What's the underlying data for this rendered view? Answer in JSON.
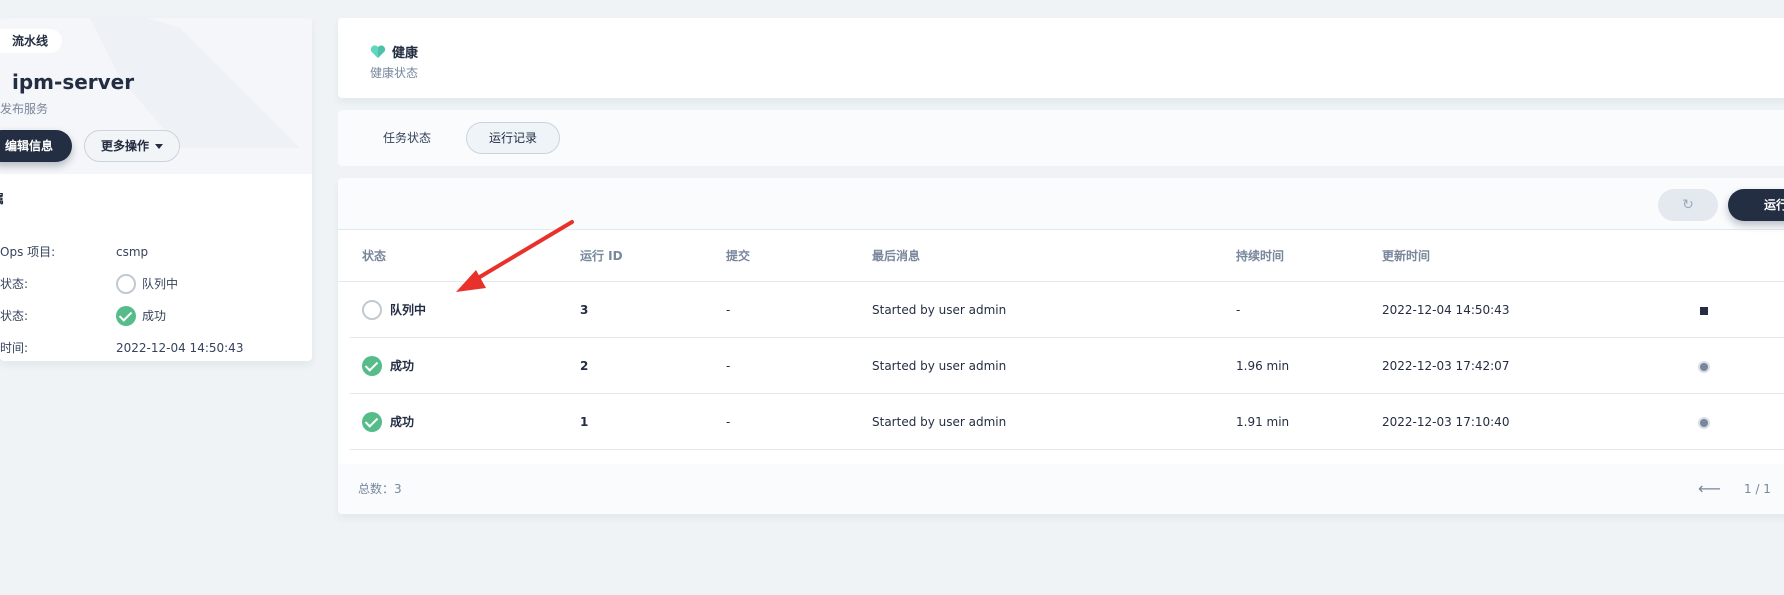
{
  "left": {
    "type_tag": "流水线",
    "name": "ipm-server",
    "description": "发布服务",
    "edit_button": "编辑信息",
    "more_button": "更多操作",
    "section_title": "属",
    "info": [
      {
        "label": "Ops 项目:",
        "value": "csmp",
        "status": ""
      },
      {
        "label": "状态:",
        "value": "队列中",
        "status": "queued"
      },
      {
        "label": "状态:",
        "value": "成功",
        "status": "success"
      },
      {
        "label": "时间:",
        "value": "2022-12-04 14:50:43",
        "status": ""
      }
    ]
  },
  "health": {
    "title": "健康",
    "subtitle": "健康状态"
  },
  "tabs": [
    {
      "label": "任务状态",
      "active": false
    },
    {
      "label": "运行记录",
      "active": true
    }
  ],
  "toolbar": {
    "refresh_icon": "refresh-icon",
    "run_button": "运行"
  },
  "table": {
    "columns": [
      "状态",
      "运行 ID",
      "提交",
      "最后消息",
      "持续时间",
      "更新时间"
    ],
    "rows": [
      {
        "status": "队列中",
        "status_type": "queued",
        "id": "3",
        "commit": "-",
        "message": "Started by user admin",
        "duration": "-",
        "updated": "2022-12-04 14:50:43",
        "action": "stop-icon"
      },
      {
        "status": "成功",
        "status_type": "success",
        "id": "2",
        "commit": "-",
        "message": "Started by user admin",
        "duration": "1.96 min",
        "updated": "2022-12-03 17:42:07",
        "action": "rerun-icon"
      },
      {
        "status": "成功",
        "status_type": "success",
        "id": "1",
        "commit": "-",
        "message": "Started by user admin",
        "duration": "1.91 min",
        "updated": "2022-12-03 17:10:40",
        "action": "rerun-icon"
      }
    ]
  },
  "footer": {
    "total": "总数：3",
    "page": "1 / 1"
  },
  "colors": {
    "dark": "#242e42",
    "success": "#55bc8a",
    "annotation": "#e8312a"
  }
}
